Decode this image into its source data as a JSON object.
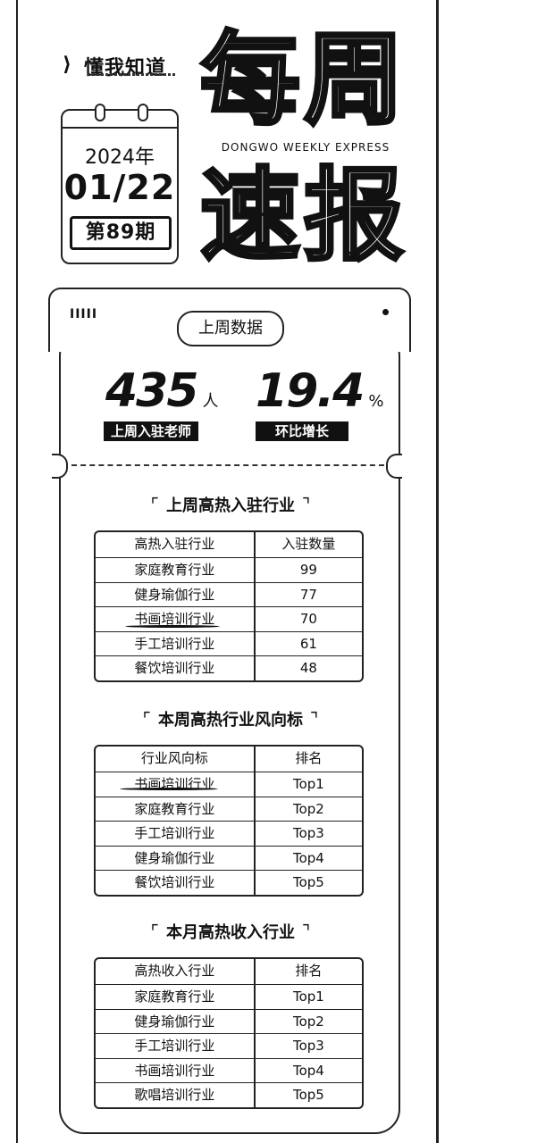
{
  "brand": {
    "name": "懂我知道"
  },
  "calendar": {
    "year": "2024年",
    "date": "01/22",
    "issue": "第89期"
  },
  "title": {
    "line1": "每周",
    "line2": "速报",
    "tagline": "DONGWO WEEKLY EXPRESS"
  },
  "last_week": {
    "tab_marks": "IIIII",
    "label": "上周数据",
    "stats": [
      {
        "value": "435",
        "unit": "人",
        "label": "上周入驻老师"
      },
      {
        "value": "19.4",
        "unit": "%",
        "label": "环比增长"
      }
    ]
  },
  "sections": [
    {
      "title": "上周高热入驻行业",
      "headers": [
        "高热入驻行业",
        "入驻数量"
      ],
      "rows": [
        [
          "家庭教育行业",
          "99"
        ],
        [
          "健身瑜伽行业",
          "77"
        ],
        [
          "书画培训行业",
          "70"
        ],
        [
          "手工培训行业",
          "61"
        ],
        [
          "餐饮培训行业",
          "48"
        ]
      ]
    },
    {
      "title": "本周高热行业风向标",
      "headers": [
        "行业风向标",
        "排名"
      ],
      "rows": [
        [
          "书画培训行业",
          "Top1"
        ],
        [
          "家庭教育行业",
          "Top2"
        ],
        [
          "手工培训行业",
          "Top3"
        ],
        [
          "健身瑜伽行业",
          "Top4"
        ],
        [
          "餐饮培训行业",
          "Top5"
        ]
      ]
    },
    {
      "title": "本月高热收入行业",
      "headers": [
        "高热收入行业",
        "排名"
      ],
      "rows": [
        [
          "家庭教育行业",
          "Top1"
        ],
        [
          "健身瑜伽行业",
          "Top2"
        ],
        [
          "手工培训行业",
          "Top3"
        ],
        [
          "书画培训行业",
          "Top4"
        ],
        [
          "歌唱培训行业",
          "Top5"
        ]
      ]
    }
  ]
}
